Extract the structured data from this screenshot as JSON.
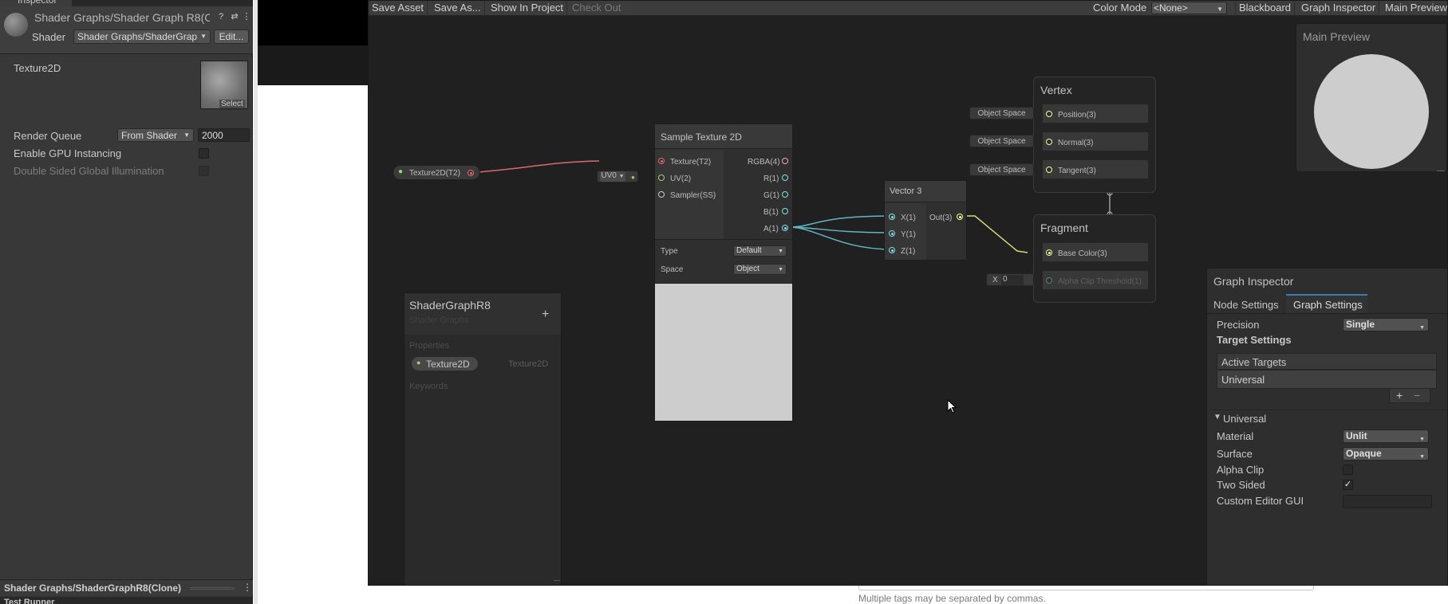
{
  "inspector": {
    "tab_label": "Inspector",
    "title": "Shader Graphs/Shader Graph R8(C",
    "shader_label": "Shader",
    "shader_value": "Shader Graphs/ShaderGrap",
    "edit_button": "Edit...",
    "texture_label": "Texture2D",
    "texture_select": "Select",
    "render_queue_label": "Render Queue",
    "render_queue_mode": "From Shader",
    "render_queue_value": "2000",
    "gpu_instancing_label": "Enable GPU Instancing",
    "double_sided_gi_label": "Double Sided Global Illumination",
    "footer_title": "Shader Graphs/ShaderGraphR8(Clone)",
    "bottom_tab": "Test Runner"
  },
  "toolbar": {
    "save_asset": "Save Asset",
    "save_as": "Save As...",
    "show_in_project": "Show In Project",
    "check_out": "Check Out",
    "color_mode_label": "Color Mode",
    "color_mode_value": "<None>",
    "blackboard": "Blackboard",
    "graph_inspector": "Graph Inspector",
    "main_preview": "Main Preview"
  },
  "property_node": {
    "label": "Texture2D(T2)"
  },
  "sample_node": {
    "title": "Sample Texture 2D",
    "inputs": [
      "Texture(T2)",
      "UV(2)",
      "Sampler(SS)"
    ],
    "outputs": [
      "RGBA(4)",
      "R(1)",
      "G(1)",
      "B(1)",
      "A(1)"
    ],
    "uv_chip": "UV0",
    "type_label": "Type",
    "type_value": "Default",
    "space_label": "Space",
    "space_value": "Object"
  },
  "vector_node": {
    "title": "Vector 3",
    "inputs": [
      "X(1)",
      "Y(1)",
      "Z(1)"
    ],
    "output": "Out(3)"
  },
  "vertex": {
    "title": "Vertex",
    "slots": [
      "Position(3)",
      "Normal(3)",
      "Tangent(3)"
    ],
    "space_chip": "Object Space"
  },
  "fragment": {
    "title": "Fragment",
    "slots": [
      "Base Color(3)",
      "Alpha Clip Threshold(1)"
    ],
    "x_label": "X",
    "x_value": "0"
  },
  "blackboard": {
    "title": "ShaderGraphR8",
    "subtitle": "Shader Graphs",
    "add_symbol": "+",
    "properties_label": "Properties",
    "property_name": "Texture2D",
    "property_type": "Texture2D",
    "keywords_label": "Keywords"
  },
  "main_preview": {
    "title": "Main Preview"
  },
  "graph_inspector": {
    "title": "Graph Inspector",
    "tabs": [
      "Node Settings",
      "Graph Settings"
    ],
    "active_tab": "Graph Settings",
    "precision_label": "Precision",
    "precision_value": "Single",
    "target_settings": "Target Settings",
    "active_targets": "Active Targets",
    "target_item": "Universal",
    "universal_section": "Universal",
    "material_label": "Material",
    "material_value": "Unlit",
    "surface_label": "Surface",
    "surface_value": "Opaque",
    "alpha_clip_label": "Alpha Clip",
    "alpha_clip_checked": false,
    "two_sided_label": "Two Sided",
    "two_sided_checked": true,
    "custom_editor_label": "Custom Editor GUI",
    "custom_editor_value": ""
  },
  "page": {
    "tags_hint": "Multiple tags may be separated by commas."
  },
  "colors": {
    "texture_port": "#e36a6a",
    "vector1_port": "#84e4e7",
    "vector3_port": "#f6ff9a",
    "edge_texture": "#d96b6b",
    "edge_vector1": "#5fb8c6",
    "edge_vector3": "#d2d67a"
  }
}
